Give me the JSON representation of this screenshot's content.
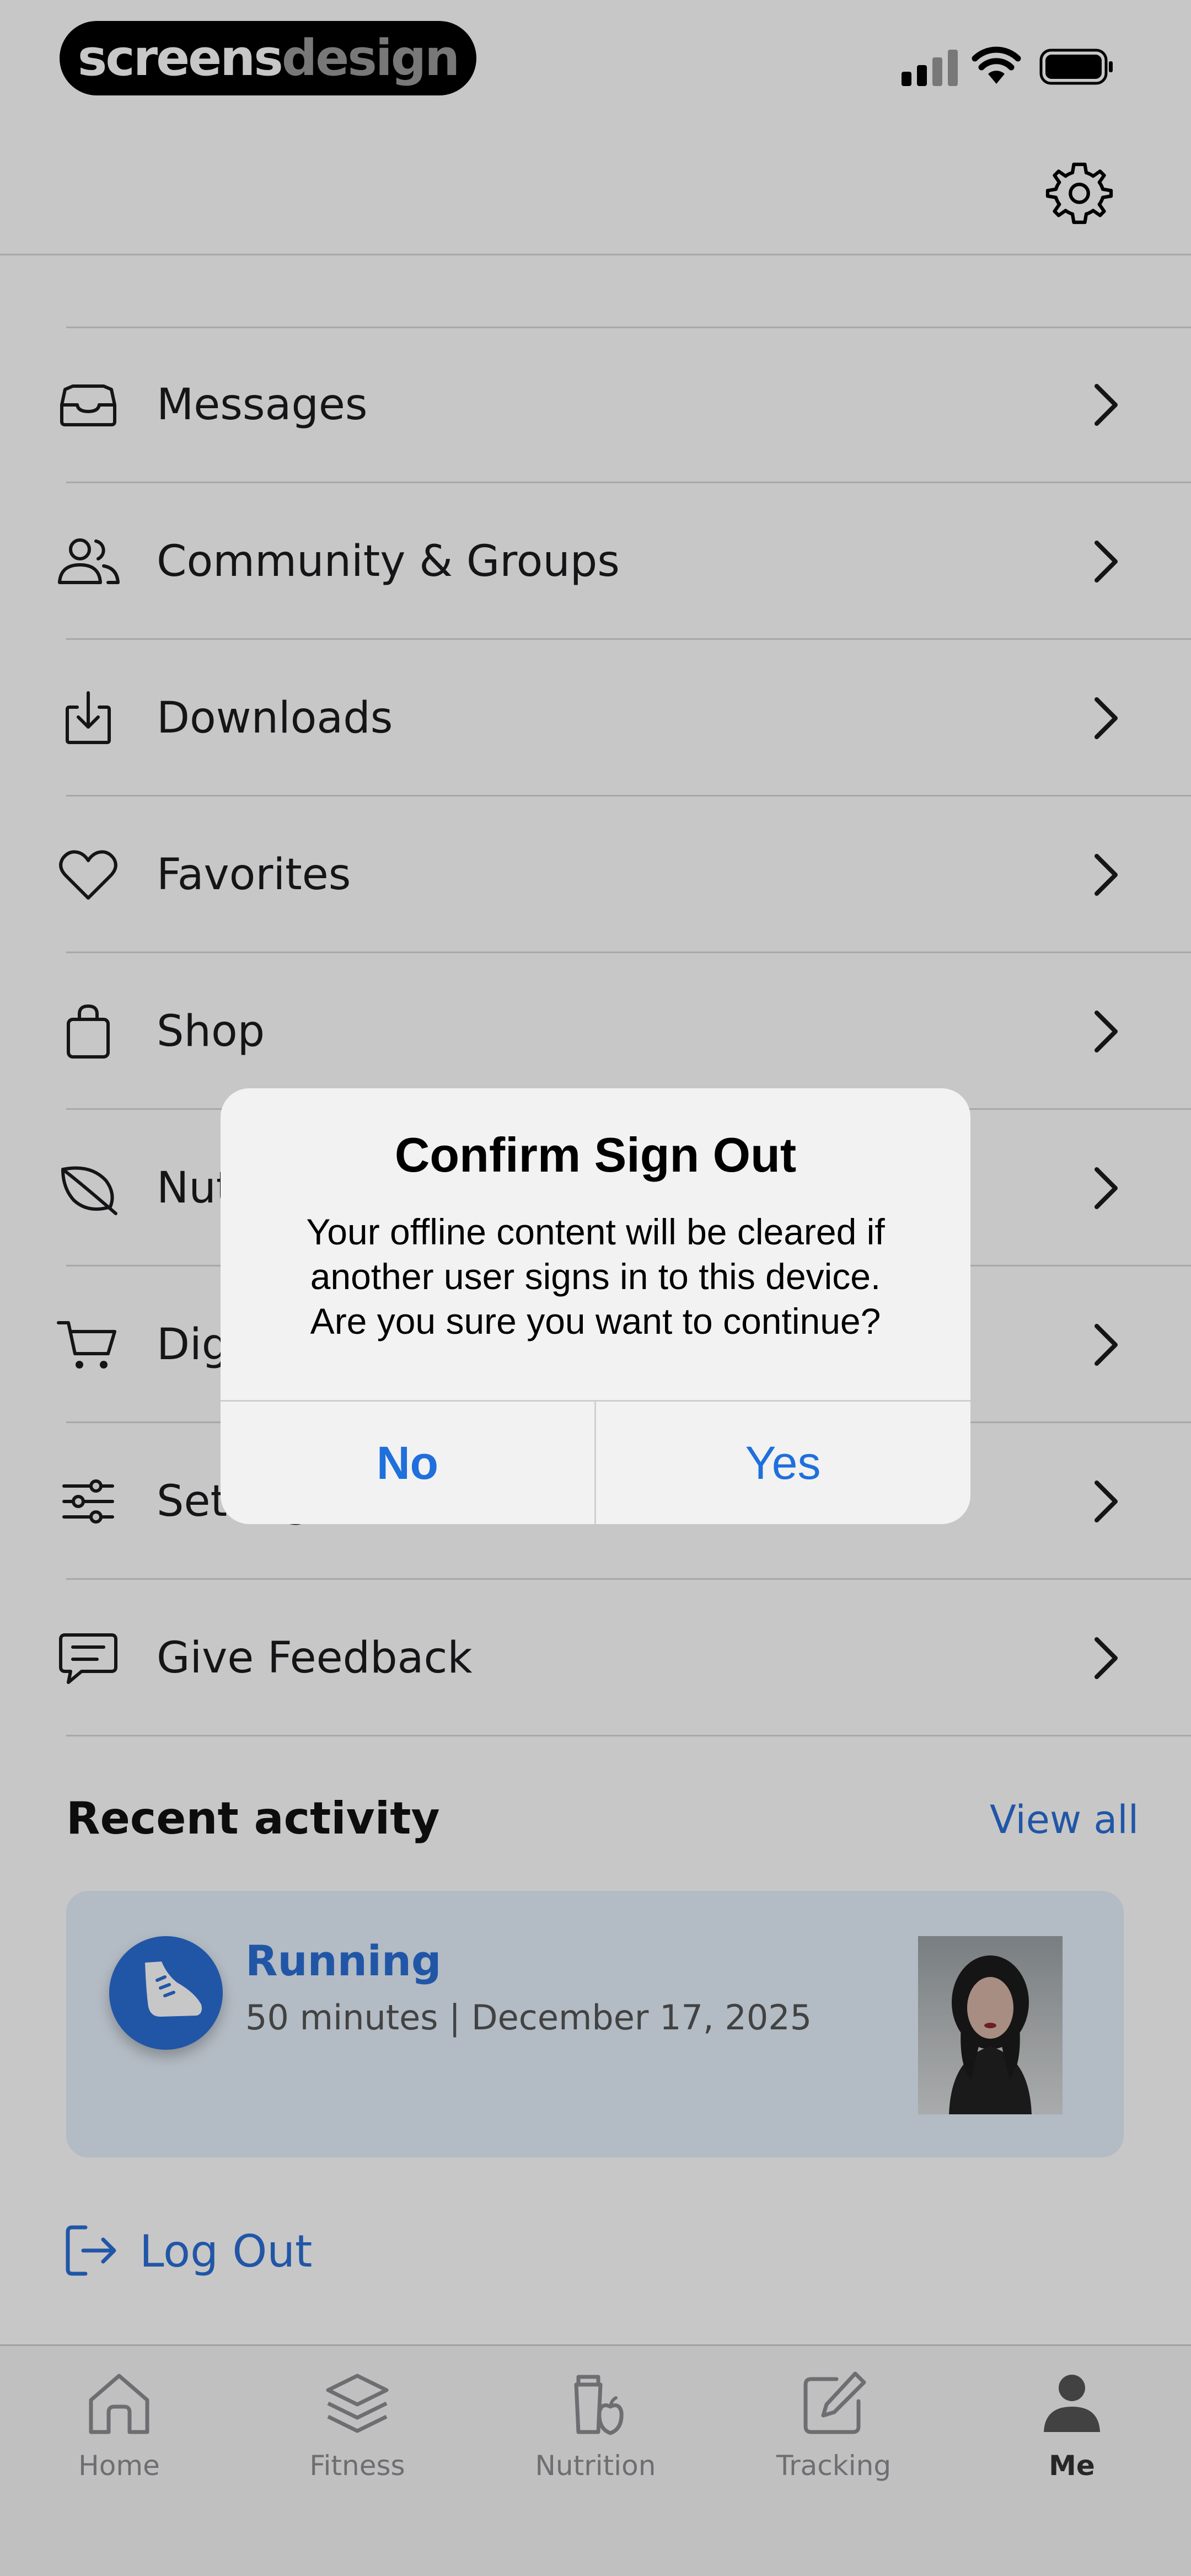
{
  "status_bar": {
    "brand_part1": "screens",
    "brand_part2": "design"
  },
  "menu": {
    "items": [
      {
        "label": "Messages",
        "icon": "inbox-icon"
      },
      {
        "label": "Community & Groups",
        "icon": "people-icon"
      },
      {
        "label": "Downloads",
        "icon": "download-icon"
      },
      {
        "label": "Favorites",
        "icon": "heart-icon"
      },
      {
        "label": "Shop",
        "icon": "bag-icon"
      },
      {
        "label": "Nutrition",
        "icon": "leaf-icon"
      },
      {
        "label": "Digital Products",
        "icon": "cart-icon"
      },
      {
        "label": "Settings",
        "icon": "sliders-icon"
      },
      {
        "label": "Give Feedback",
        "icon": "feedback-icon"
      }
    ]
  },
  "recent_activity": {
    "title": "Recent activity",
    "view_all": "View all",
    "card": {
      "title": "Running",
      "subtitle": "50 minutes | December 17, 2025"
    }
  },
  "logout": {
    "label": "Log Out"
  },
  "tabbar": {
    "tabs": [
      {
        "label": "Home",
        "icon": "home-icon"
      },
      {
        "label": "Fitness",
        "icon": "layers-icon"
      },
      {
        "label": "Nutrition",
        "icon": "nutrition-icon"
      },
      {
        "label": "Tracking",
        "icon": "edit-icon"
      },
      {
        "label": "Me",
        "icon": "person-icon"
      }
    ],
    "active": "Me"
  },
  "alert": {
    "title": "Confirm Sign Out",
    "message_line1": "Your offline content will be cleared if",
    "message_line2": "another user signs in to this device.",
    "message_line3": "Are you sure you want to continue?",
    "no_label": "No",
    "yes_label": "Yes"
  },
  "colors": {
    "accent": "#2b6fd6",
    "card_background": "#e6f0fb",
    "overlay": "rgba(0,0,0,0.22)"
  }
}
